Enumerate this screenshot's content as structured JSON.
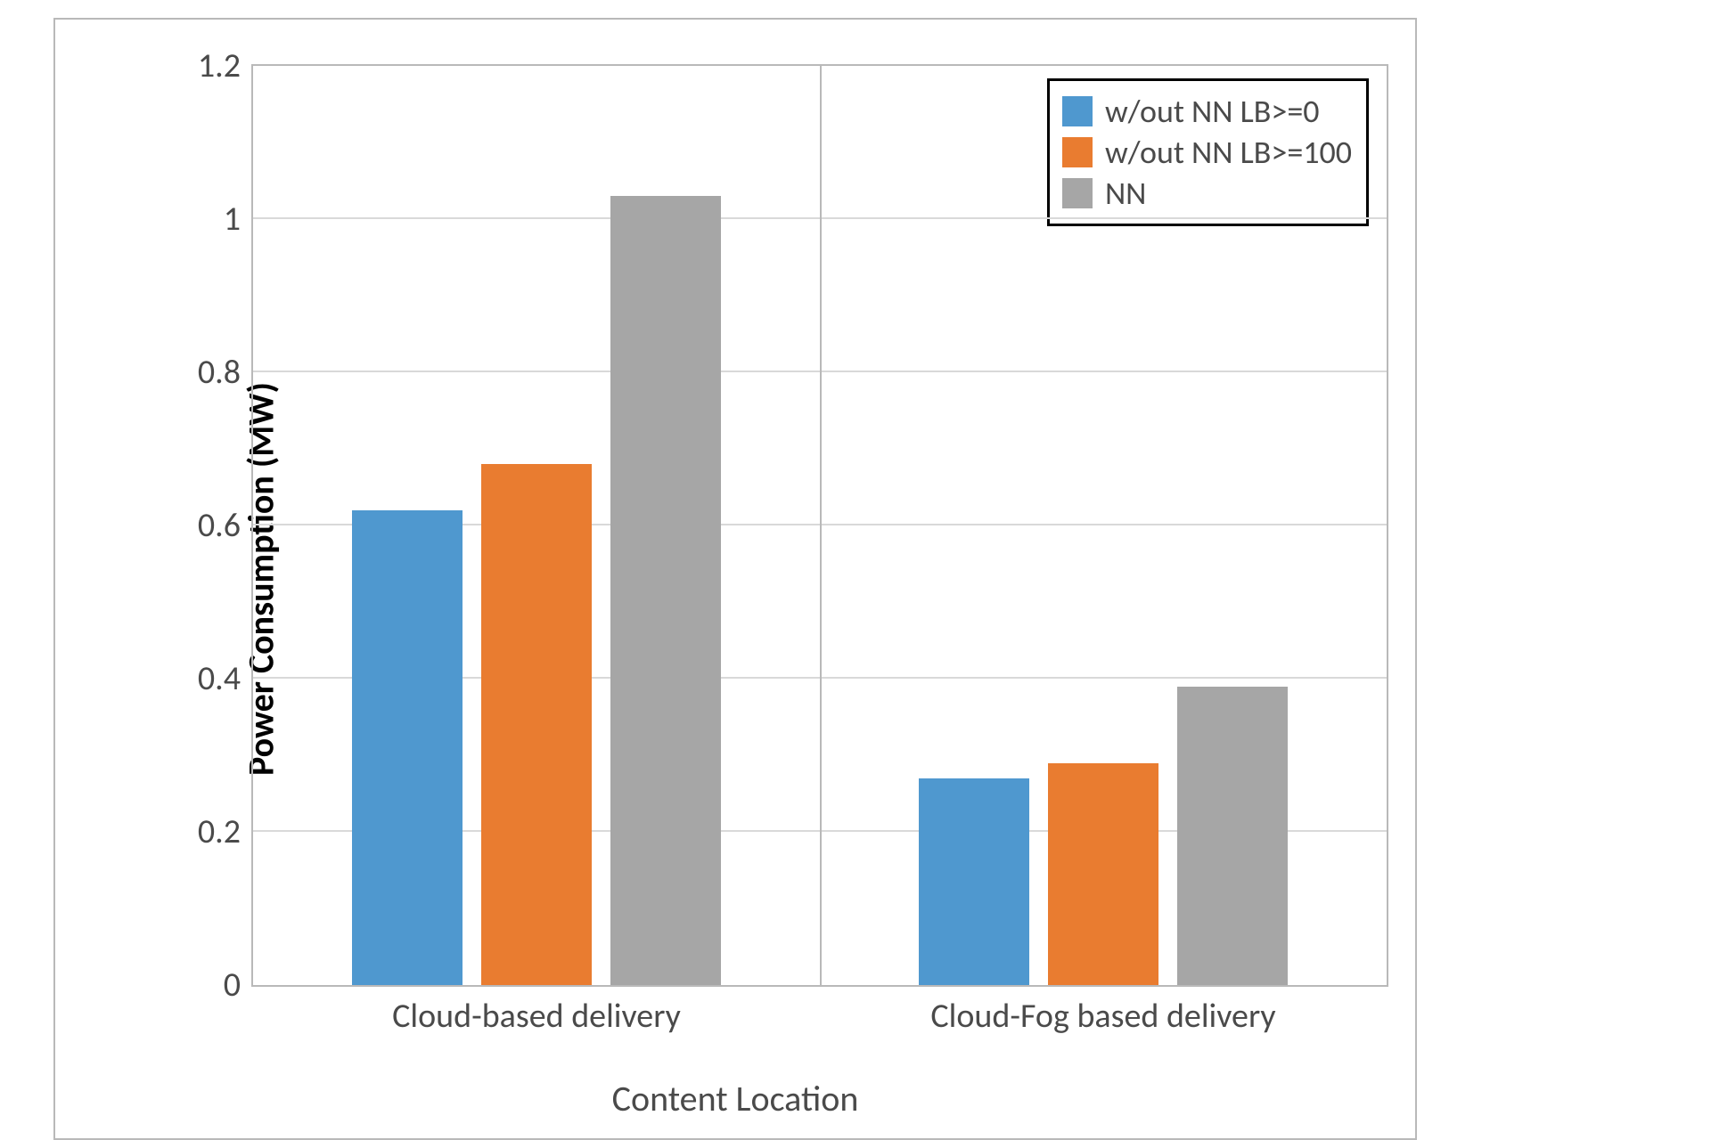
{
  "chart_data": {
    "type": "bar",
    "title": "",
    "xlabel": "Content Location",
    "ylabel": "Power Consumption (MW)",
    "ylim": [
      0,
      1.2
    ],
    "yticks": [
      0,
      0.2,
      0.4,
      0.6,
      0.8,
      1,
      1.2
    ],
    "categories": [
      "Cloud-based delivery",
      "Cloud-Fog based delivery"
    ],
    "series": [
      {
        "name": "w/out NN LB>=0",
        "color": "#4f98cf",
        "values": [
          0.62,
          0.27
        ]
      },
      {
        "name": "w/out NN LB>=100",
        "color": "#e97c30",
        "values": [
          0.68,
          0.29
        ]
      },
      {
        "name": "NN",
        "color": "#a6a6a6",
        "values": [
          1.03,
          0.39
        ]
      }
    ],
    "legend_position": "top-right"
  }
}
